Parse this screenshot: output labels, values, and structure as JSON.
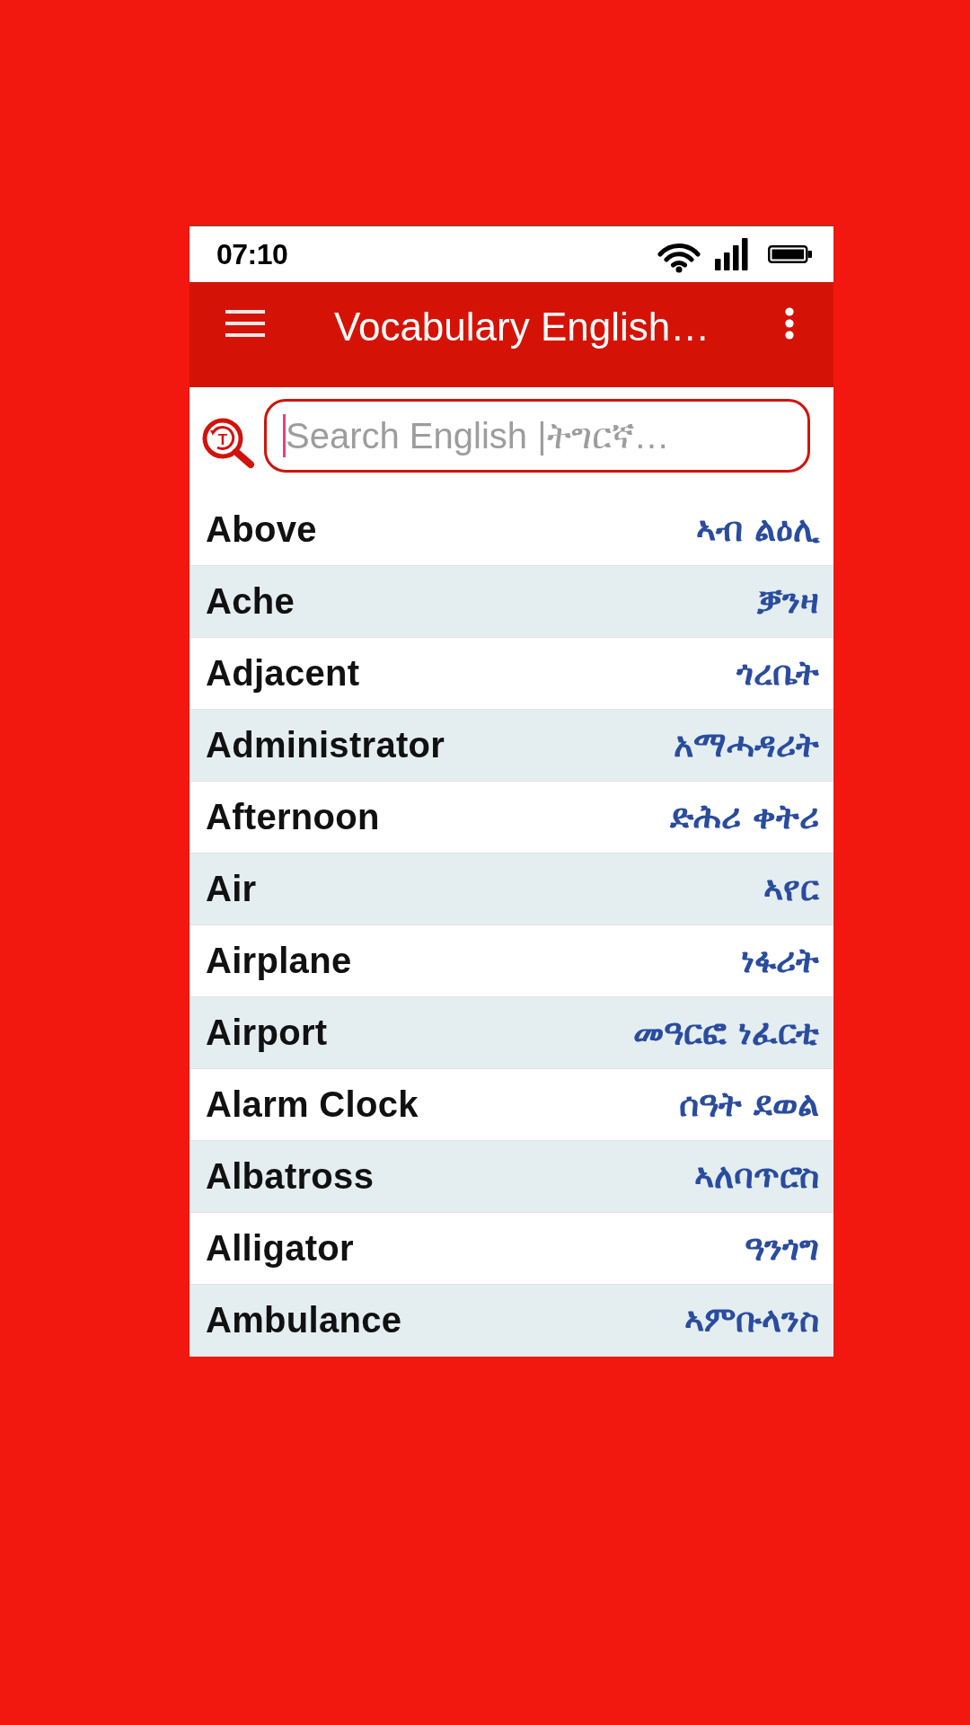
{
  "status_bar": {
    "time": "07:10"
  },
  "app_bar": {
    "title": "Vocabulary English…"
  },
  "search": {
    "icon_letter": "T",
    "placeholder": "Search English |ትግርኛ…",
    "focused": true
  },
  "words": [
    {
      "english": "Above",
      "tigrinya": "ኣብ ልዕሊ"
    },
    {
      "english": "Ache",
      "tigrinya": "ቓንዛ"
    },
    {
      "english": "Adjacent",
      "tigrinya": "ጎረቤት"
    },
    {
      "english": "Administrator",
      "tigrinya": "አማሓዳሪት"
    },
    {
      "english": "Afternoon",
      "tigrinya": "ድሕሪ ቀትሪ"
    },
    {
      "english": "Air",
      "tigrinya": "ኣየር"
    },
    {
      "english": "Airplane",
      "tigrinya": "ነፋሪት"
    },
    {
      "english": "Airport",
      "tigrinya": "መዓርፎ ነፈርቲ"
    },
    {
      "english": "Alarm Clock",
      "tigrinya": "ሰዓት ደወል"
    },
    {
      "english": "Albatross",
      "tigrinya": "ኣለባጥሮስ"
    },
    {
      "english": "Alligator",
      "tigrinya": "ዓንጎግ"
    },
    {
      "english": "Ambulance",
      "tigrinya": "ኣምቡላንስ"
    }
  ]
}
